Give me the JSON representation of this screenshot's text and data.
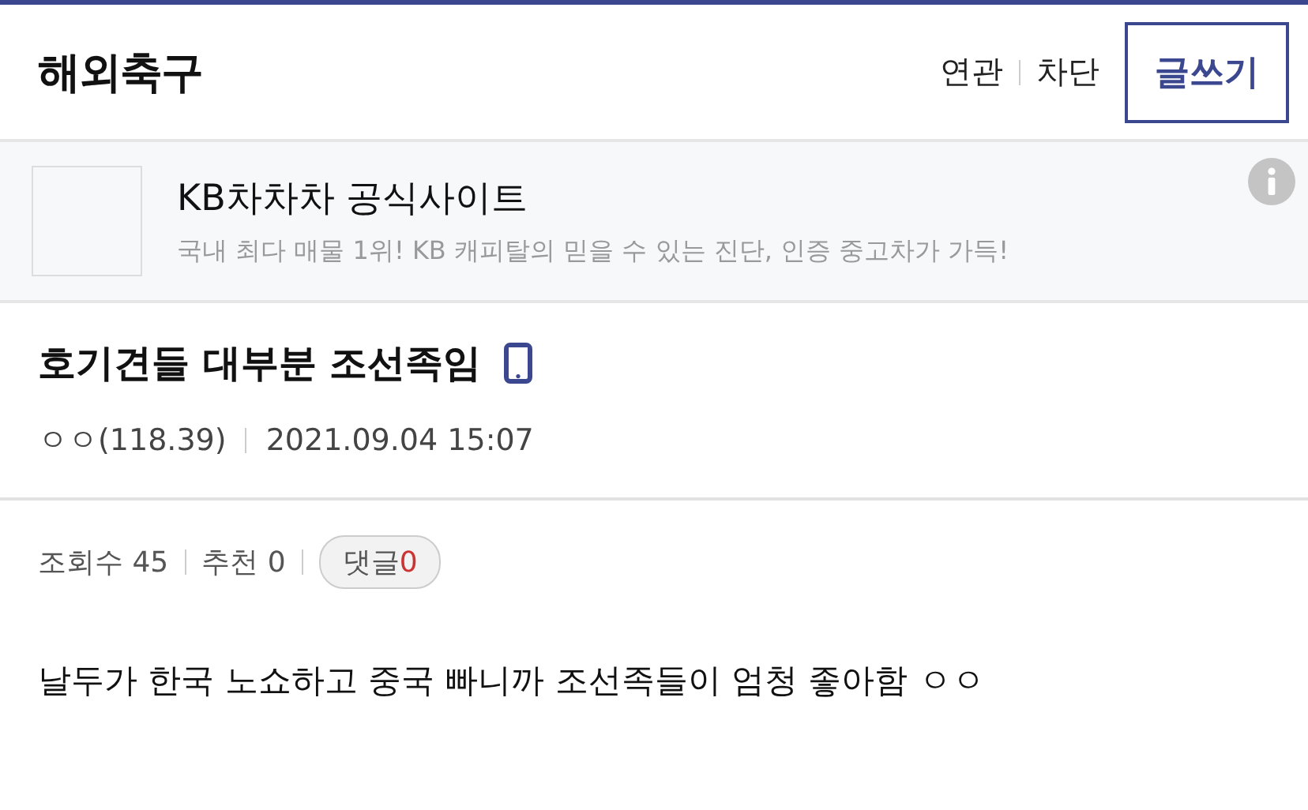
{
  "header": {
    "title": "해외축구",
    "links": [
      "연관",
      "차단"
    ],
    "write_button": "글쓰기"
  },
  "ad": {
    "title": "KB차차차 공식사이트",
    "description": "국내 최다 매물 1위! KB 캐피탈의 믿을 수 있는 진단, 인증 중고차가 가득!"
  },
  "post": {
    "title": "호기견들 대부분 조선족임",
    "author": "ㅇㅇ(118.39)",
    "date": "2021.09.04 15:07",
    "views": "조회수 45",
    "recommend": "추천 0",
    "comments_label": "댓글",
    "comments_count": "0",
    "body": "날두가 한국 노쇼하고 중국 빠니까 조선족들이 엄청 좋아함 ㅇㅇ"
  }
}
